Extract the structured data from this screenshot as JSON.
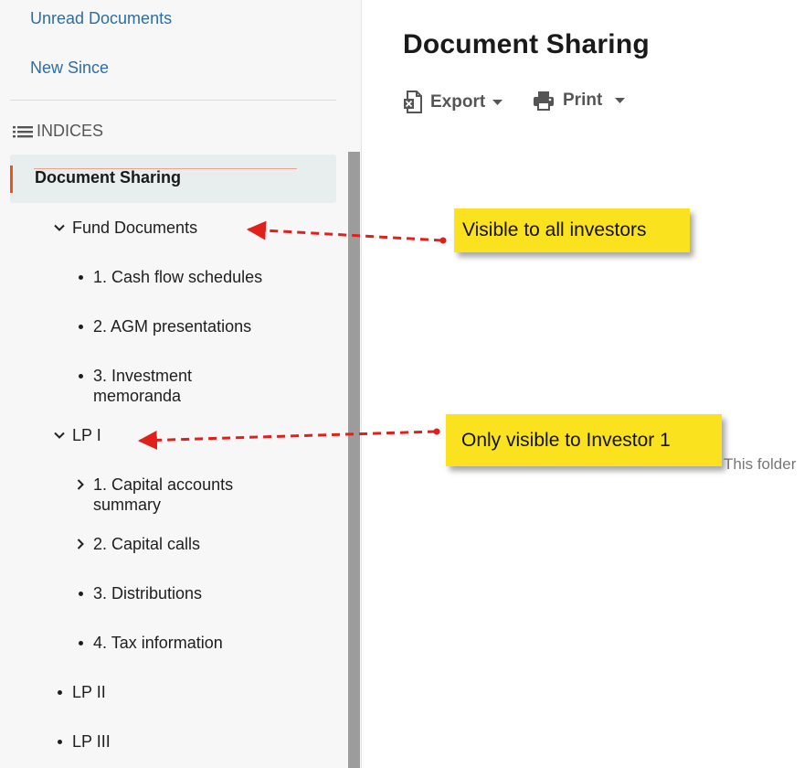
{
  "sidebar": {
    "links": {
      "unread": "Unread Documents",
      "new_since": "New Since"
    },
    "indices_label": "INDICES",
    "active_item": "Document Sharing",
    "tree": {
      "fund_documents": "Fund Documents",
      "cash_flow": "1. Cash flow schedules",
      "agm": "2. AGM presentations",
      "investment_line1": "3. Investment",
      "investment_line2": "memoranda",
      "lp1": "LP I",
      "capital_accounts_line1": "1. Capital accounts",
      "capital_accounts_line2": "summary",
      "capital_calls": "2. Capital calls",
      "distributions": "3. Distributions",
      "tax": "4. Tax information",
      "lp2": "LP II",
      "lp3": "LP III"
    }
  },
  "main": {
    "title": "Document Sharing",
    "toolbar": {
      "export_label": "Export",
      "print_label": "Print"
    },
    "folder_note": "This folder"
  },
  "annotations": {
    "visible_all": "Visible to all investors",
    "visible_investor1": "Only visible to Investor 1"
  },
  "colors": {
    "link": "#2e6da4",
    "accent_bar": "#e8561e",
    "callout": "#fae21e",
    "arrow": "#e0201b"
  },
  "icons": {
    "indices": "list-icon",
    "export": "excel-file-icon",
    "print": "printer-icon",
    "expanded": "chevron-down-icon",
    "collapsed": "chevron-right-icon"
  }
}
